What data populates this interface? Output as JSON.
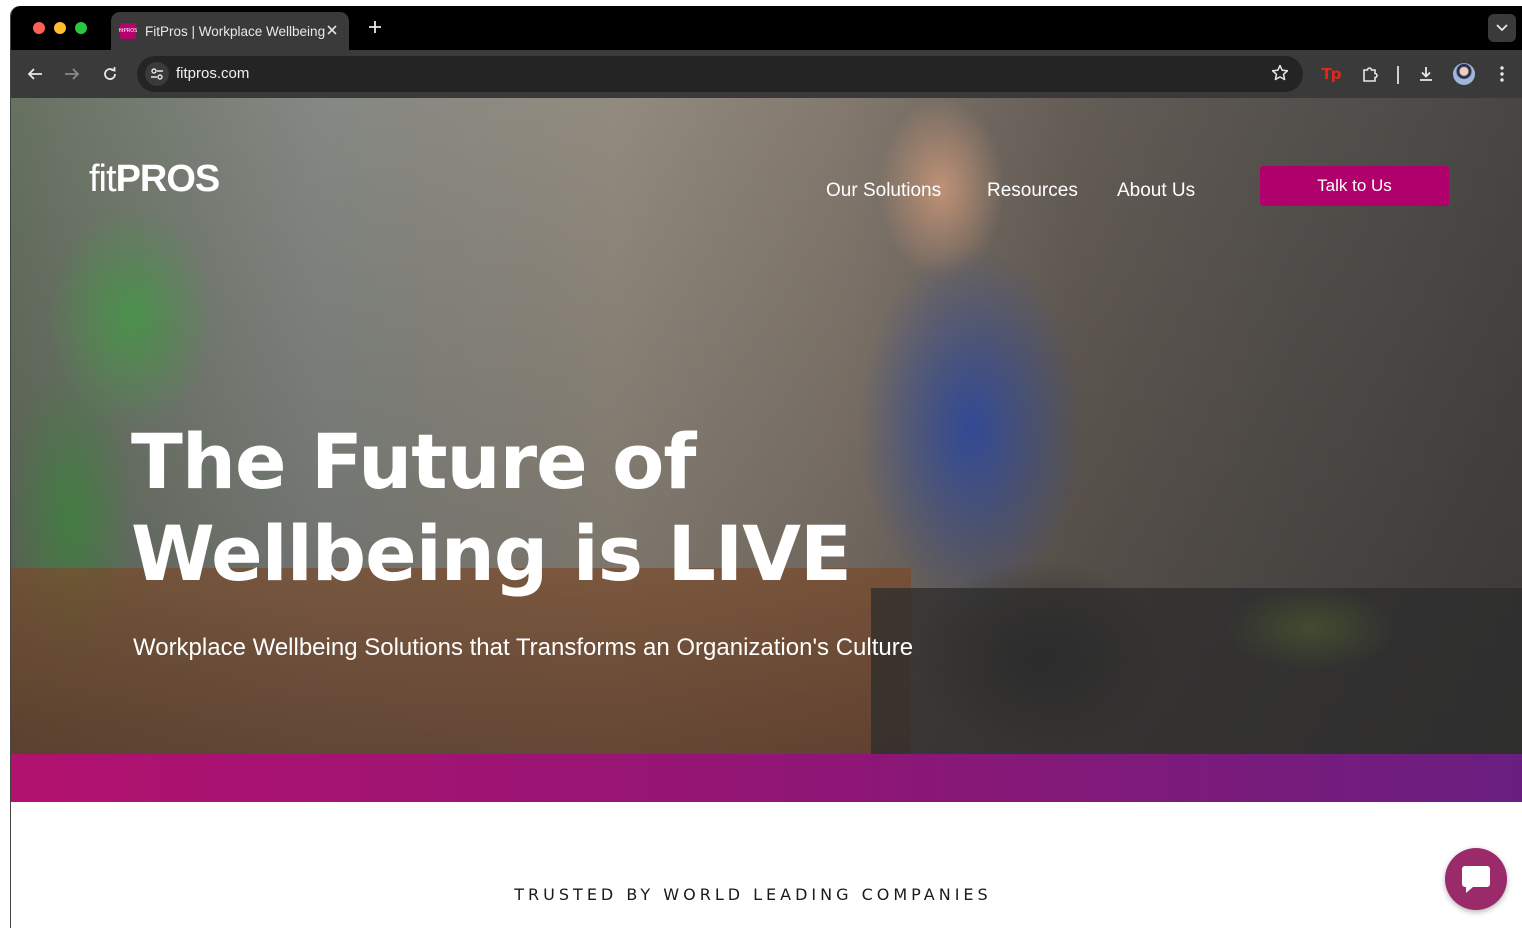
{
  "browser": {
    "tab": {
      "title": "FitPros | Workplace Wellbeing",
      "favicon_text": "fitPROS",
      "close_icon": "close-icon"
    },
    "new_tab_icon": "plus-icon",
    "address": {
      "url": "fitpros.com"
    },
    "toolbar_icons": [
      "back-icon",
      "forward-icon",
      "reload-icon",
      "site-info-icon",
      "star-icon",
      "tp-extension-icon",
      "puzzle-icon",
      "download-icon",
      "avatar",
      "kebab-menu-icon"
    ],
    "tp_extension_label": "Tp",
    "traffic_lights": {
      "close": "#ff5f57",
      "minimize": "#febc2e",
      "zoom": "#28c840"
    }
  },
  "site": {
    "logo": {
      "light": "fit",
      "bold": "PROS"
    },
    "nav": [
      {
        "label": "Our Solutions"
      },
      {
        "label": "Resources"
      },
      {
        "label": "About Us"
      }
    ],
    "cta_label": "Talk to Us",
    "hero": {
      "headline_line1": "The Future of",
      "headline_line2": "Wellbeing is LIVE",
      "subheading": "Workplace Wellbeing Solutions that Transforms an Organization's Culture"
    },
    "trusted_heading": "TRUSTED BY WORLD LEADING COMPANIES",
    "colors": {
      "brand": "#b0006c",
      "band_start": "#b3126f",
      "band_end": "#6a1f80",
      "chat": "#9b2a6a"
    }
  }
}
